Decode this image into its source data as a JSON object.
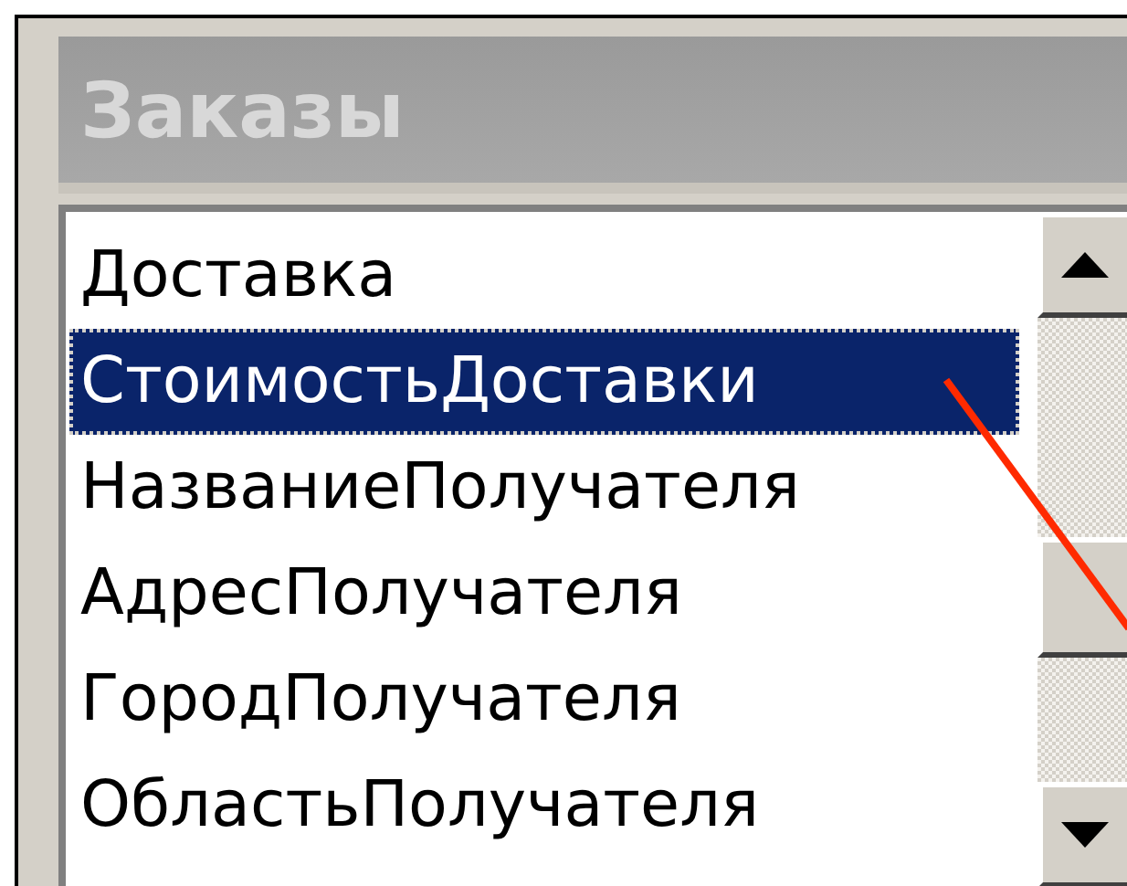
{
  "window": {
    "title": "Заказы"
  },
  "fields": [
    {
      "label": "Доставка",
      "selected": false
    },
    {
      "label": "СтоимостьДоставки",
      "selected": true
    },
    {
      "label": "НазваниеПолучателя",
      "selected": false
    },
    {
      "label": "АдресПолучателя",
      "selected": false
    },
    {
      "label": "ГородПолучателя",
      "selected": false
    },
    {
      "label": "ОбластьПолучателя",
      "selected": false
    }
  ]
}
